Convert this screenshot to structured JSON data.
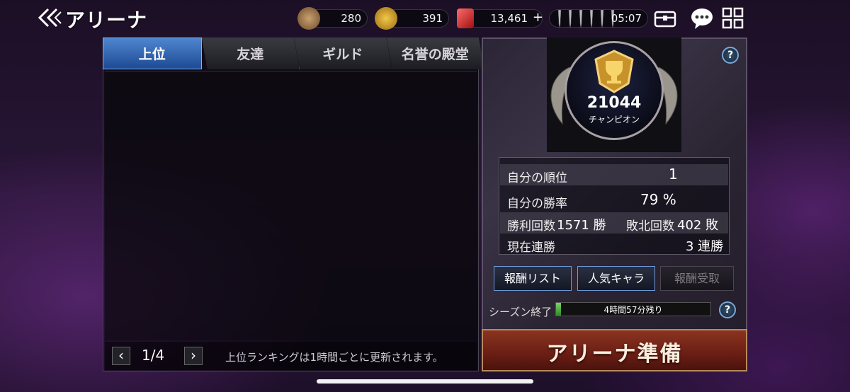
{
  "header": {
    "title": "アリーナ",
    "back_icon": "double-chevron-left-icon"
  },
  "resources": {
    "sword_medal": "280",
    "gold_medal": "391",
    "gems": "13,461",
    "gems_plus": "+",
    "stamina_timer": "05:07"
  },
  "tabs": [
    "上位",
    "友達",
    "ギルド",
    "名誉の殿堂"
  ],
  "pager": {
    "current": "1/4",
    "note": "上位ランキングは1時間ごとに更新されます。"
  },
  "profile": {
    "score": "21044",
    "rank_name": "チャンピオン"
  },
  "stats": {
    "rank_label": "自分の順位",
    "rank_value": "1",
    "winrate_label": "自分の勝率",
    "winrate_value": "79 %",
    "wins_label": "勝利回数",
    "wins_value": "1571 勝",
    "losses_label": "敗北回数",
    "losses_value": "402 敗",
    "streak_label": "現在連勝",
    "streak_value": "3 連勝"
  },
  "buttons": {
    "reward_list": "報酬リスト",
    "popular_chars": "人気キャラ",
    "reward_claim": "報酬受取",
    "prepare": "アリーナ準備"
  },
  "season": {
    "label": "シーズン終了",
    "remaining": "4時間57分残り",
    "progress": 0.03
  },
  "colors": {
    "accent_blue": "#3d7ac9",
    "progress_green": "#5fbf4c",
    "prepare_red": "#7a2618"
  }
}
